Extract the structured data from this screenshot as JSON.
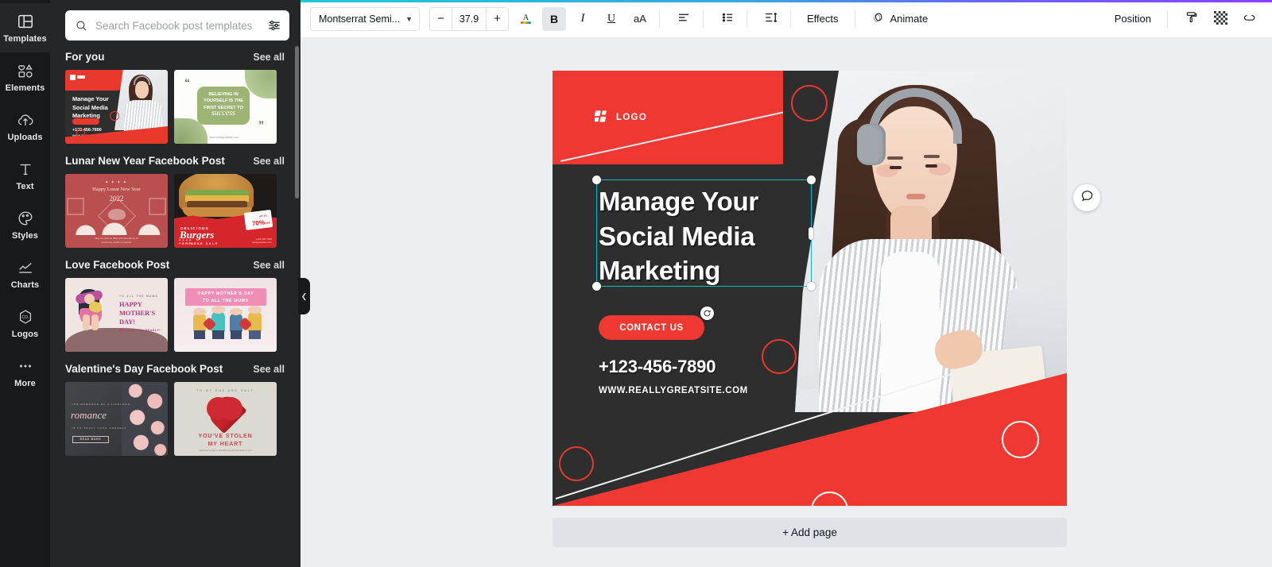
{
  "rail": {
    "items": [
      {
        "label": "Templates",
        "icon": "templates-icon",
        "active": true
      },
      {
        "label": "Elements",
        "icon": "elements-icon",
        "active": false
      },
      {
        "label": "Uploads",
        "icon": "uploads-icon",
        "active": false
      },
      {
        "label": "Text",
        "icon": "text-icon",
        "active": false
      },
      {
        "label": "Styles",
        "icon": "styles-icon",
        "active": false
      },
      {
        "label": "Charts",
        "icon": "charts-icon",
        "active": false
      },
      {
        "label": "Logos",
        "icon": "logos-icon",
        "active": false
      },
      {
        "label": "More",
        "icon": "more-icon",
        "active": false
      }
    ]
  },
  "search": {
    "placeholder": "Search Facebook post templates",
    "value": "",
    "search_icon": "search-icon",
    "filter_icon": "filter-sliders-icon"
  },
  "panel": {
    "see_all_label": "See all",
    "next_arrow": "›",
    "sections": [
      {
        "title": "For you",
        "templates": [
          {
            "name": "Manage Your Social Media Marketing",
            "style": "red-dark-social"
          },
          {
            "name": "Believing in yourself is the first secret to success",
            "style": "green-quote"
          }
        ]
      },
      {
        "title": "Lunar New Year Facebook Post",
        "templates": [
          {
            "name": "Happy Lunar New Year 2022",
            "style": "red-lunar"
          },
          {
            "name": "Delicious Burgers Chinese Sale - Up to 70% Off",
            "style": "burger-sale"
          }
        ]
      },
      {
        "title": "Love Facebook Post",
        "templates": [
          {
            "name": "Happy Mother's Day! We love you dearly",
            "style": "mothers-day-illustration"
          },
          {
            "name": "Happy Mother's Day to all the mums",
            "style": "mothers-day-group"
          }
        ]
      },
      {
        "title": "Valentine's Day Facebook Post",
        "templates": [
          {
            "name": "Romance - The romance of a lifetime",
            "style": "roses-romance"
          },
          {
            "name": "You've stolen my heart",
            "style": "red-heart"
          }
        ]
      }
    ],
    "collapse_icon": "chevron-left-icon"
  },
  "toolbar": {
    "font_name": "Montserrat Semi...",
    "font_caret_icon": "chevron-down-icon",
    "font_size": "37.9",
    "decrease_label": "−",
    "increase_label": "+",
    "text_color_icon": "text-color-icon",
    "bold_label": "B",
    "italic_label": "I",
    "underline_label": "U",
    "case_label": "aA",
    "align_icon": "align-left-icon",
    "list_icon": "bullet-list-icon",
    "spacing_icon": "line-spacing-icon",
    "effects_label": "Effects",
    "animate_label": "Animate",
    "animate_icon": "animate-icon",
    "position_label": "Position",
    "copy_style_icon": "paint-roller-icon",
    "transparency_icon": "transparency-icon",
    "lock_link_icon": "link-icon",
    "accent_start": "#1ec9d4",
    "accent_end": "#8b3ffd"
  },
  "stage": {
    "duplicate_page_icon": "duplicate-page-icon",
    "add_page_icon": "add-page-icon",
    "comment_icon": "comment-bubble-icon",
    "add_page_label": "+ Add page"
  },
  "design": {
    "logo_text": "LOGO",
    "logo_icon": "logo-mark-icon",
    "headline": "Manage Your Social Media Marketing",
    "cta_label": "CONTACT US",
    "phone": "+123-456-7890",
    "website": "WWW.REALLYGREATSITE.COM",
    "colors": {
      "red": "#ee3831",
      "dark": "#2e2e2e",
      "white": "#ffffff",
      "selection": "#14b8c4"
    },
    "rotate_icon": "rotate-handle-icon"
  }
}
